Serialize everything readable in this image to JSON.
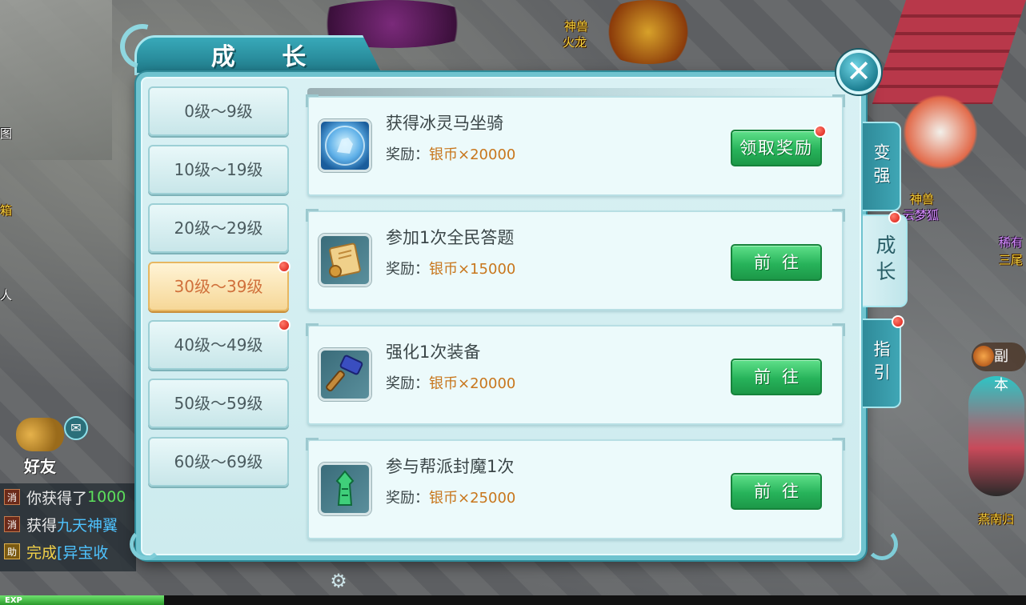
{
  "panel": {
    "title": "成 长",
    "close_label": "✕"
  },
  "level_tabs": [
    {
      "label": "0级～9级",
      "badge": false,
      "active": false
    },
    {
      "label": "10级～19级",
      "badge": false,
      "active": false
    },
    {
      "label": "20级～29级",
      "badge": false,
      "active": false
    },
    {
      "label": "30级～39级",
      "badge": true,
      "active": true
    },
    {
      "label": "40级～49级",
      "badge": true,
      "active": false
    },
    {
      "label": "50级～59级",
      "badge": false,
      "active": false
    },
    {
      "label": "60级～69级",
      "badge": false,
      "active": false
    }
  ],
  "tasks": [
    {
      "title": "获得冰灵马坐骑",
      "reward_label": "奖励：",
      "reward_value": "银币×20000",
      "button": "领取奖励",
      "badge": true,
      "icon": "ice-spirit-horse-icon"
    },
    {
      "title": "参加1次全民答题",
      "reward_label": "奖励：",
      "reward_value": "银币×15000",
      "button": "前往",
      "badge": false,
      "icon": "scroll-icon"
    },
    {
      "title": "强化1次装备",
      "reward_label": "奖励：",
      "reward_value": "银币×20000",
      "button": "前往",
      "badge": false,
      "icon": "hammer-icon"
    },
    {
      "title": "参与帮派封魔1次",
      "reward_label": "奖励：",
      "reward_value": "银币×25000",
      "button": "前往",
      "badge": false,
      "icon": "jade-tower-icon"
    }
  ],
  "side_tabs": [
    {
      "label": "变强",
      "badge": false,
      "active": false
    },
    {
      "label": "成长",
      "badge": true,
      "active": true
    },
    {
      "label": "指引",
      "badge": true,
      "active": false
    }
  ],
  "world": {
    "npc_labels": [
      "神兽",
      "火龙",
      "神兽",
      "云梦狐",
      "稀有",
      "三尾",
      "燕南归",
      "图",
      "箱",
      "人"
    ],
    "dungeon_label": "副本",
    "friend_label": "好友"
  },
  "chat": [
    {
      "tag": "消",
      "segments": [
        {
          "text": "你获得了",
          "color": "white"
        },
        {
          "text": "1000",
          "color": "green"
        }
      ]
    },
    {
      "tag": "消",
      "segments": [
        {
          "text": "获得",
          "color": "white"
        },
        {
          "text": "九天神翼",
          "color": "blue"
        }
      ]
    },
    {
      "tag": "助",
      "segments": [
        {
          "text": "完成",
          "color": "yellow"
        },
        {
          "text": "[异宝收",
          "color": "blue"
        }
      ]
    }
  ],
  "exp_label": "EXP",
  "colors": {
    "accent": "#3fa6b5",
    "button_green": "#27b35a",
    "reward_orange": "#c8761c",
    "active_tab": "#f6d797",
    "badge_red": "#d81a12"
  }
}
